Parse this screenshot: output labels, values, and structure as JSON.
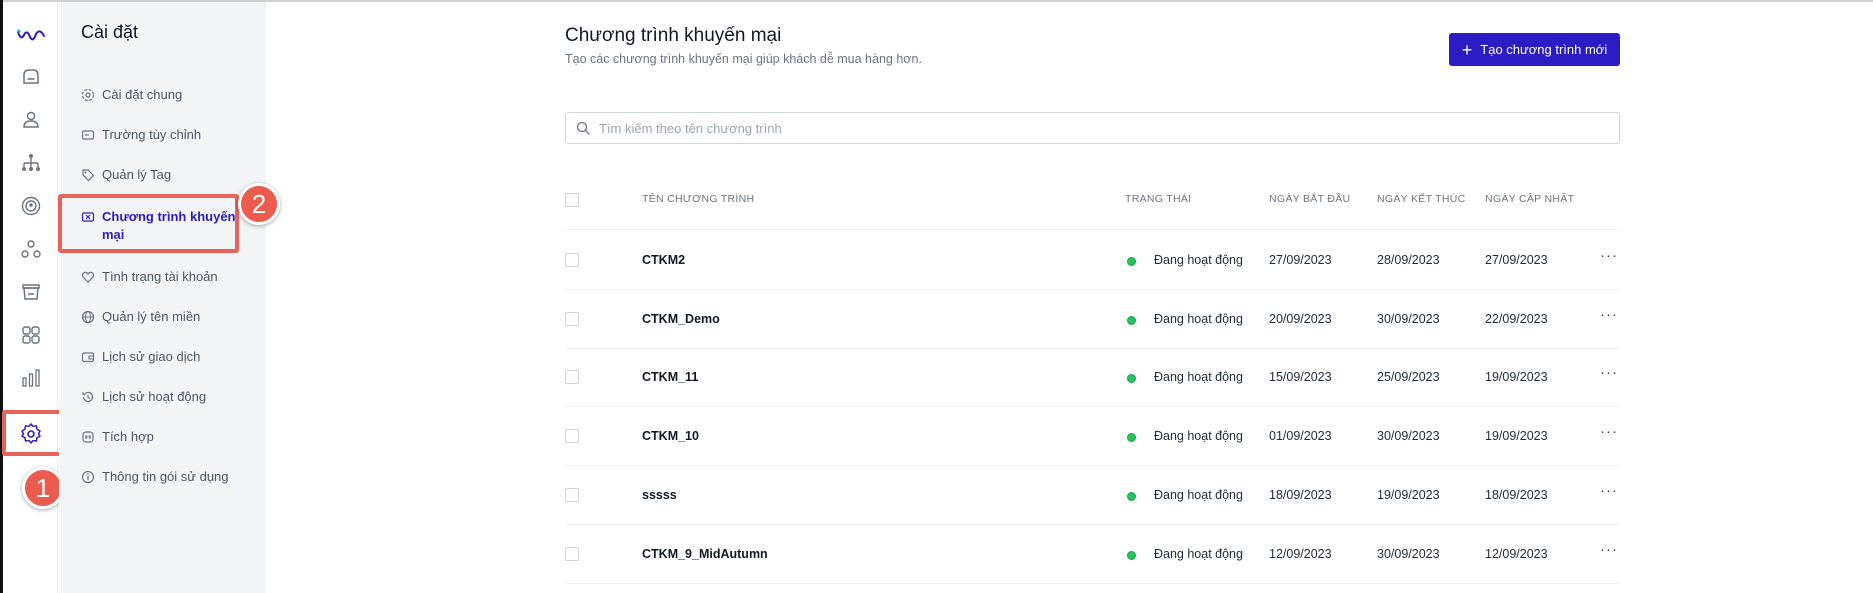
{
  "colors": {
    "primary": "#2b1cc4",
    "highlight": "#e8645a",
    "badge": "#eb5c4f",
    "status_active": "#22c55e",
    "settings_bg": "#f3f4f6"
  },
  "rail": {
    "icons": [
      "logo-icon",
      "inbox-icon",
      "user-icon",
      "sitemap-icon",
      "broadcast-icon",
      "segments-icon",
      "shop-icon",
      "apps-grid-icon",
      "bar-chart-icon",
      "gear-icon"
    ]
  },
  "callouts": {
    "one": "1",
    "two": "2"
  },
  "settings": {
    "title": "Cài đặt",
    "items": [
      {
        "label": "Cài đặt chung",
        "icon": "gear-icon"
      },
      {
        "label": "Trường tùy chỉnh",
        "icon": "custom-field-icon"
      },
      {
        "label": "Quản lý Tag",
        "icon": "tag-icon"
      },
      {
        "label": "Chương trình khuyến mại",
        "icon": "ticket-icon",
        "active": true
      },
      {
        "label": "Tình trạng tài khoản",
        "icon": "heart-icon"
      },
      {
        "label": "Quản lý tên miền",
        "icon": "globe-icon"
      },
      {
        "label": "Lịch sử giao dịch",
        "icon": "wallet-icon"
      },
      {
        "label": "Lịch sử hoạt động",
        "icon": "history-icon"
      },
      {
        "label": "Tích hợp",
        "icon": "integration-icon"
      },
      {
        "label": "Thông tin gói sử dụng",
        "icon": "info-icon"
      }
    ]
  },
  "main": {
    "title": "Chương trình khuyến mại",
    "subtitle": "Tạo các chương trình khuyến mại giúp khách dễ mua hàng hơn.",
    "create_button": "Tạo chương trình mới",
    "search_placeholder": "Tìm kiếm theo tên chương trình"
  },
  "table": {
    "columns": [
      "TÊN CHƯƠNG TRÌNH",
      "TRẠNG THÁI",
      "NGÀY BẮT ĐẦU",
      "NGÀY KẾT THÚC",
      "NGÀY CẬP NHẬT"
    ],
    "rows": [
      {
        "name": "CTKM2",
        "status": "Đang hoạt động",
        "start": "27/09/2023",
        "end": "28/09/2023",
        "updated": "27/09/2023",
        "more": "···"
      },
      {
        "name": "CTKM_Demo",
        "status": "Đang hoạt động",
        "start": "20/09/2023",
        "end": "30/09/2023",
        "updated": "22/09/2023",
        "more": "···"
      },
      {
        "name": "CTKM_11",
        "status": "Đang hoạt động",
        "start": "15/09/2023",
        "end": "25/09/2023",
        "updated": "19/09/2023",
        "more": "···"
      },
      {
        "name": "CTKM_10",
        "status": "Đang hoạt động",
        "start": "01/09/2023",
        "end": "30/09/2023",
        "updated": "19/09/2023",
        "more": "···"
      },
      {
        "name": "sssss",
        "status": "Đang hoạt động",
        "start": "18/09/2023",
        "end": "19/09/2023",
        "updated": "18/09/2023",
        "more": "···"
      },
      {
        "name": "CTKM_9_MidAutumn",
        "status": "Đang hoạt động",
        "start": "12/09/2023",
        "end": "30/09/2023",
        "updated": "12/09/2023",
        "more": "···"
      }
    ]
  }
}
